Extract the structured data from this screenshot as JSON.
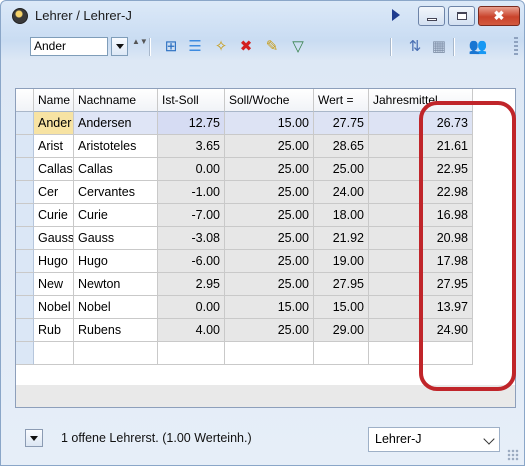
{
  "window": {
    "title": "Lehrer / Lehrer-J",
    "close_glyph": "✖"
  },
  "toolbar": {
    "filter_combo_value": "Ander",
    "spin_glyph": "▲▼",
    "icons": [
      {
        "name": "grid-icon",
        "glyph": "⊞",
        "color": "#2a6fc1"
      },
      {
        "name": "list-icon",
        "glyph": "☰",
        "color": "#3d8be0"
      },
      {
        "name": "new-icon",
        "glyph": "✧",
        "color": "#c79a11"
      },
      {
        "name": "delete-icon",
        "glyph": "✖",
        "color": "#d31f1f"
      },
      {
        "name": "edit-icon",
        "glyph": "✎",
        "color": "#c79a11"
      },
      {
        "name": "filter-icon",
        "glyph": "▽",
        "color": "#38824e"
      },
      {
        "name": "sort-icon",
        "glyph": "⇅",
        "color": "#4a6fb3"
      },
      {
        "name": "calc-icon",
        "glyph": "▦",
        "color": "#8090a8"
      },
      {
        "name": "users-icon",
        "glyph": "👥",
        "color": "#a04e8e"
      }
    ]
  },
  "table": {
    "columns": [
      "Name",
      "Nachname",
      "Ist-Soll",
      "Soll/Woche",
      "Wert =",
      "Jahresmittel"
    ],
    "rows": [
      [
        "Ander",
        "Andersen",
        "12.75",
        "15.00",
        "27.75",
        "26.73"
      ],
      [
        "Arist",
        "Aristoteles",
        "3.65",
        "25.00",
        "28.65",
        "21.61"
      ],
      [
        "Callas",
        "Callas",
        "0.00",
        "25.00",
        "25.00",
        "22.95"
      ],
      [
        "Cer",
        "Cervantes",
        "-1.00",
        "25.00",
        "24.00",
        "22.98"
      ],
      [
        "Curie",
        "Curie",
        "-7.00",
        "25.00",
        "18.00",
        "16.98"
      ],
      [
        "Gauss",
        "Gauss",
        "-3.08",
        "25.00",
        "21.92",
        "20.98"
      ],
      [
        "Hugo",
        "Hugo",
        "-6.00",
        "25.00",
        "19.00",
        "17.98"
      ],
      [
        "New",
        "Newton",
        "2.95",
        "25.00",
        "27.95",
        "27.95"
      ],
      [
        "Nobel",
        "Nobel",
        "0.00",
        "15.00",
        "15.00",
        "13.97"
      ],
      [
        "Rub",
        "Rubens",
        "4.00",
        "25.00",
        "29.00",
        "24.90"
      ]
    ],
    "selected_row": 0,
    "highlight_color": "#c0252a"
  },
  "status": {
    "text": "1 offene Lehrerst. (1.00 Werteinh.)",
    "combo_value": "Lehrer-J"
  }
}
